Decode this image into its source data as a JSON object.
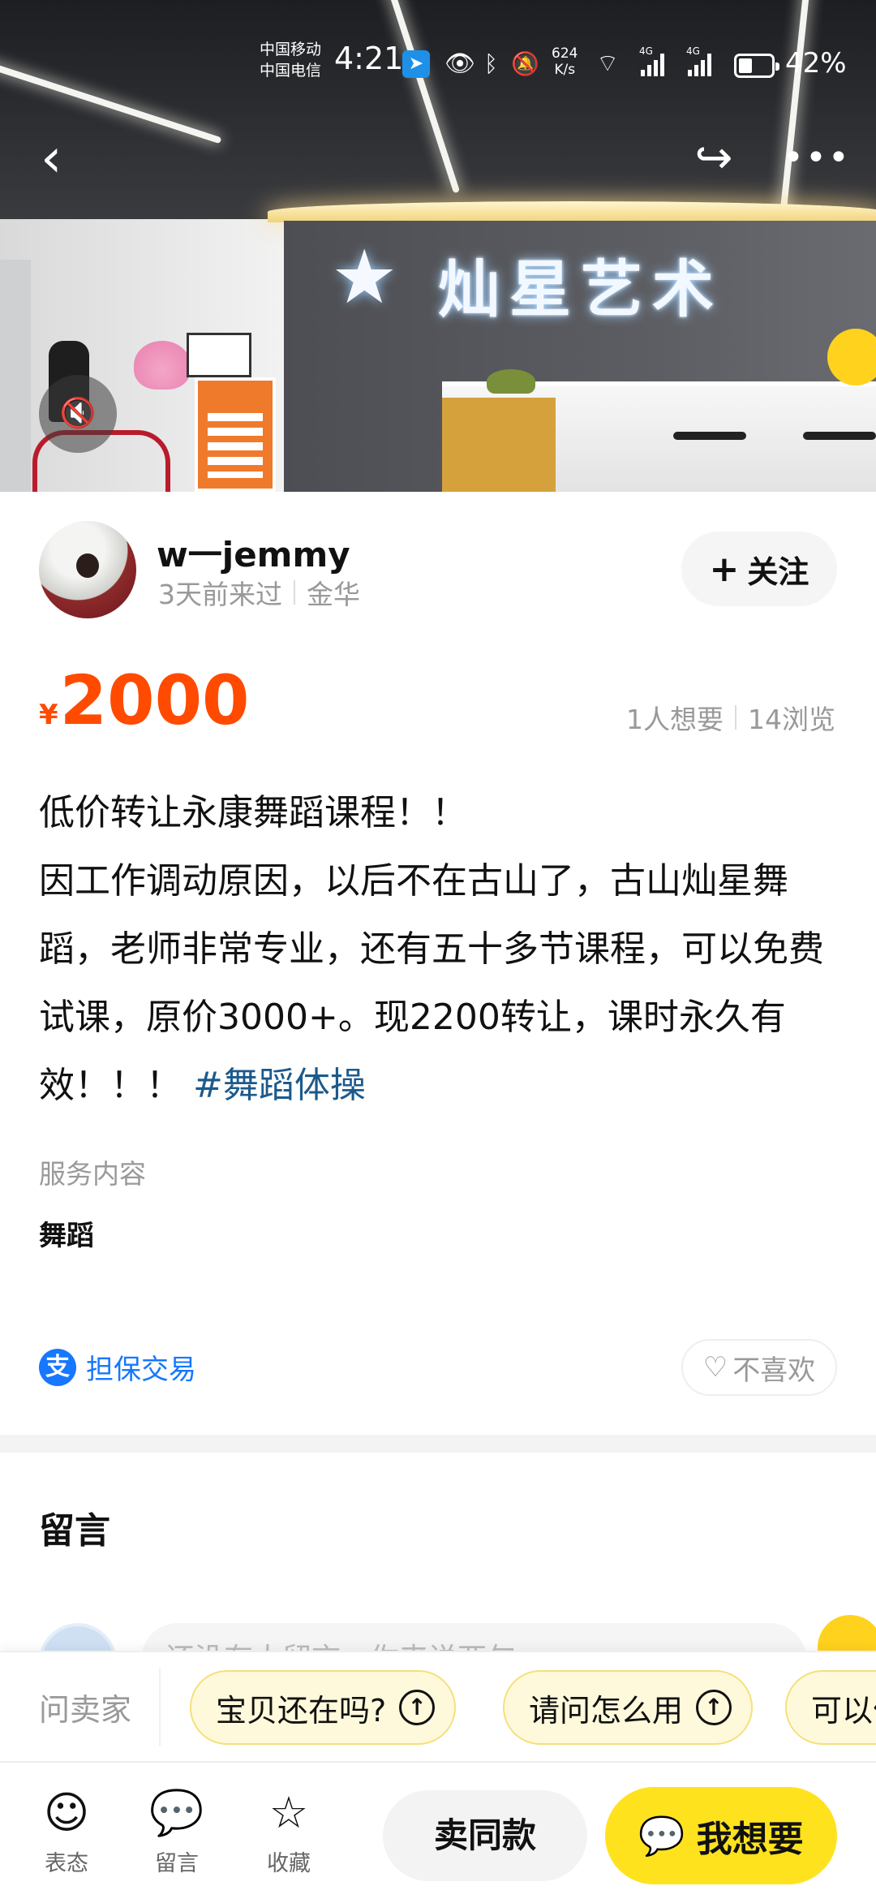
{
  "status_bar": {
    "carrier_1": "中国移动",
    "carrier_2": "中国电信",
    "time": "4:21",
    "net_speed_value": "624",
    "net_speed_unit": "K/s",
    "signal_1": "4G",
    "signal_2": "4G",
    "battery": "42%"
  },
  "hero": {
    "sign_text": "灿星艺术"
  },
  "seller": {
    "username": "w一jemmy",
    "last_seen": "3天前来过",
    "location": "金华",
    "follow_label": "关注"
  },
  "listing": {
    "currency": "¥",
    "price": "2000",
    "wants": "1人想要",
    "views": "14浏览",
    "description": "低价转让永康舞蹈课程！！\n因工作调动原因，以后不在古山了，古山灿星舞蹈，老师非常专业，还有五十多节课程，可以免费试课，原价3000+。现2200转让，课时永久有效！！！",
    "hashtag": "#舞蹈体操",
    "service_label": "服务内容",
    "service_value": "舞蹈",
    "guarantee_icon": "支",
    "guarantee": "担保交易",
    "dislike": "不喜欢"
  },
  "comments": {
    "title": "留言",
    "input_placeholder": "还没有人留言，你来说两句"
  },
  "quick_ask": {
    "label": "问卖家",
    "chips": [
      "宝贝还在吗?",
      "请问怎么用",
      "可以便宜点吗"
    ]
  },
  "bottom_bar": {
    "tabs": [
      {
        "label": "表态",
        "icon": "smiley-icon"
      },
      {
        "label": "留言",
        "icon": "chat-bubble-icon"
      },
      {
        "label": "收藏",
        "icon": "star-icon"
      }
    ],
    "sell_same": "卖同款",
    "want": "我想要"
  },
  "colors": {
    "price": "#ff4a00",
    "accent_yellow": "#ffe21e",
    "link_blue": "#1677ff",
    "hashtag_blue": "#1c5a8c"
  }
}
